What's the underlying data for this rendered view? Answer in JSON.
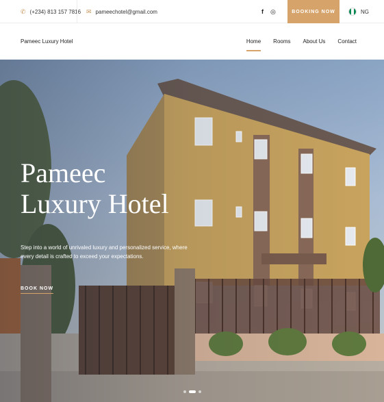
{
  "topbar": {
    "phone_icon": "phone-icon",
    "phone": "(+234) 813 157 7816",
    "email_icon": "mail-icon",
    "email": "pameechotel@gmail.com",
    "social": [
      {
        "icon": "facebook-icon",
        "glyph": "f"
      },
      {
        "icon": "instagram-icon",
        "glyph": "◎"
      }
    ],
    "book_label": "BOOKING NOW",
    "language": "NG"
  },
  "navbar": {
    "brand": "Pameec Luxury Hotel",
    "links": [
      {
        "label": "Home",
        "active": true
      },
      {
        "label": "Rooms",
        "active": false
      },
      {
        "label": "About Us",
        "active": false
      },
      {
        "label": "Contact",
        "active": false
      }
    ]
  },
  "hero": {
    "title_line1": "Pameec",
    "title_line2": "Luxury Hotel",
    "subtitle": "Step into a world of unrivaled luxury and personalized service, where every detail is crafted to exceed your expectations.",
    "cta": "BOOK NOW",
    "slides": 3,
    "active_slide": 1
  },
  "colors": {
    "accent": "#d6a46b",
    "flag_green": "#008751",
    "flag_white": "#ffffff"
  }
}
